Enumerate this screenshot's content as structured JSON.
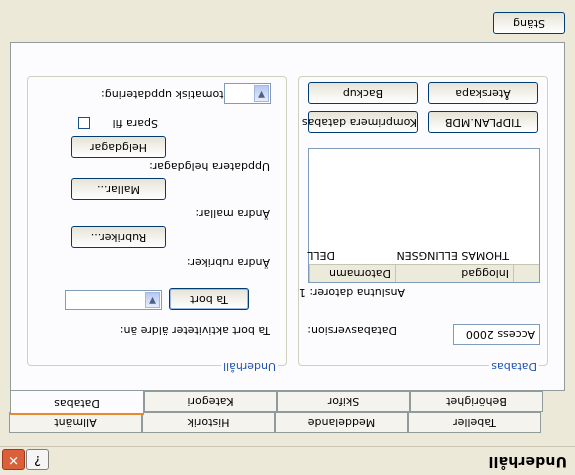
{
  "window": {
    "title": "Underhåll",
    "help_label": "?",
    "close_label": "✕"
  },
  "tabs": [
    {
      "label": "Tabeller"
    },
    {
      "label": "Meddelande"
    },
    {
      "label": "Historik"
    },
    {
      "label": "Allmänt"
    },
    {
      "label": "Behörighet"
    },
    {
      "label": "Skifor"
    },
    {
      "label": "Kategori"
    },
    {
      "label": "Databas"
    }
  ],
  "maintenance": {
    "legend": "Underhåll",
    "delete_label": "Ta bort aktiviteter äldre än:",
    "delete_button": "Ta bort",
    "date_value": "",
    "rubrics_label": "Ändra rubriker:",
    "rubrics_button": "Rubriker...",
    "templates_label": "Ändra mallar:",
    "templates_button": "Mallar...",
    "holidays_label": "Uppdatera helgdagar:",
    "holidays_button": "Helgdagar",
    "save_label": "Spara fil",
    "save_checked": false,
    "auto_label": "Automatisk uppdatering:",
    "auto_value": ""
  },
  "database": {
    "legend": "Databas",
    "version_label": "Databasversion:",
    "version_value": "Access 2000",
    "connected_label": "Anslutna datorer: 1",
    "columns": [
      "Datornamn",
      "Inloggad"
    ],
    "rows": [
      {
        "computer": "DELL",
        "user": "THOMAS ELLINGSEN"
      }
    ],
    "compact_button": "Komprimera databas",
    "file_button": "TIDPLAN.MDB",
    "backup_button": "Backup",
    "restore_button": "Återskapa"
  },
  "footer": {
    "close_button": "Stäng"
  }
}
